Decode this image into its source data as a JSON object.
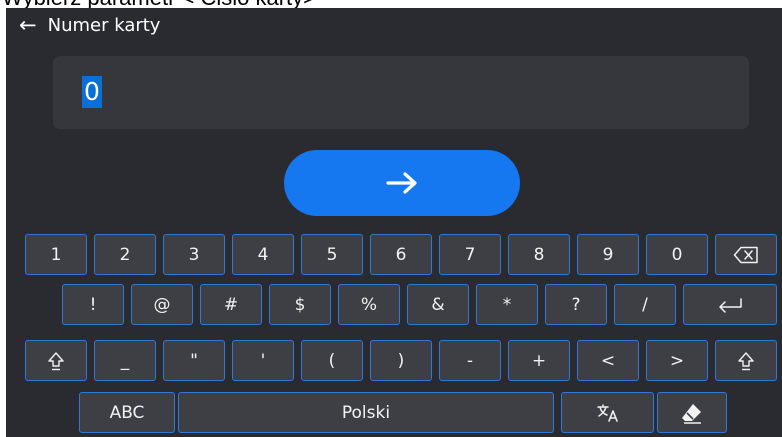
{
  "caption": "Wybierz parametr < Cisło karty>",
  "header": {
    "back_icon": "arrow-left-icon",
    "title": "Numer karty"
  },
  "input": {
    "value": "0"
  },
  "confirm": {
    "icon": "arrow-right-icon",
    "color": "#1678f0"
  },
  "keyboard": {
    "row1": [
      "1",
      "2",
      "3",
      "4",
      "5",
      "6",
      "7",
      "8",
      "9",
      "0"
    ],
    "row1_end_icon": "backspace-icon",
    "row2": [
      "!",
      "@",
      "#",
      "$",
      "%",
      "&",
      "*",
      "?",
      "/"
    ],
    "row2_end_icon": "enter-icon",
    "row3_start_icon": "shift-icon",
    "row3": [
      "_",
      "\"",
      "'",
      "(",
      ")",
      "-",
      "+",
      "<",
      ">"
    ],
    "row3_end_icon": "shift-icon",
    "row4": {
      "abc": "ABC",
      "space": "Polski",
      "translate_icon": "translate-icon",
      "clear_icon": "eraser-icon"
    }
  },
  "colors": {
    "screen_bg": "#2a2b30",
    "key_bg": "#3e3f45",
    "key_border": "#2f78d6",
    "highlight": "#0a6fd6"
  }
}
